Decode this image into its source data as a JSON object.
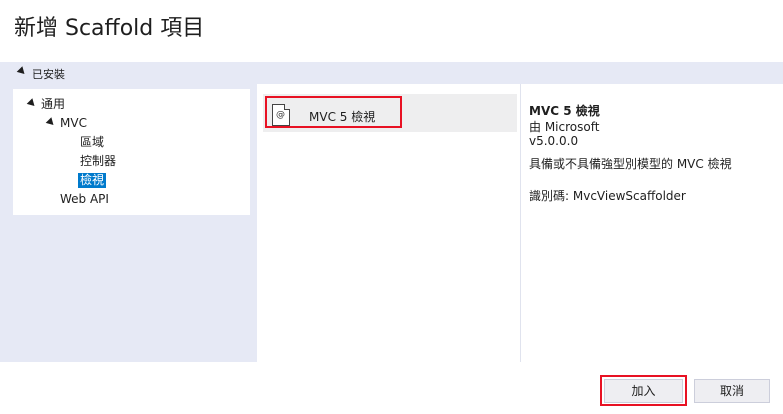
{
  "dialog": {
    "title": "新增 Scaffold 項目"
  },
  "installed_section": {
    "label": "已安裝"
  },
  "tree": {
    "common": "通用",
    "mvc": "MVC",
    "area": "區域",
    "controller": "控制器",
    "view": "檢視",
    "webapi": "Web API"
  },
  "templates": [
    {
      "label": "MVC 5 檢視",
      "icon": "razor-file-icon"
    }
  ],
  "details": {
    "name": "MVC 5 檢視",
    "publisher": "由 Microsoft",
    "version": "v5.0.0.0",
    "description": "具備或不具備強型別模型的 MVC 檢視",
    "id": "識別碼: MvcViewScaffolder"
  },
  "buttons": {
    "add": "加入",
    "cancel": "取消"
  },
  "colors": {
    "selection": "#007acc",
    "highlight_border": "#e81123",
    "panel_bg": "#e6e9f5"
  }
}
